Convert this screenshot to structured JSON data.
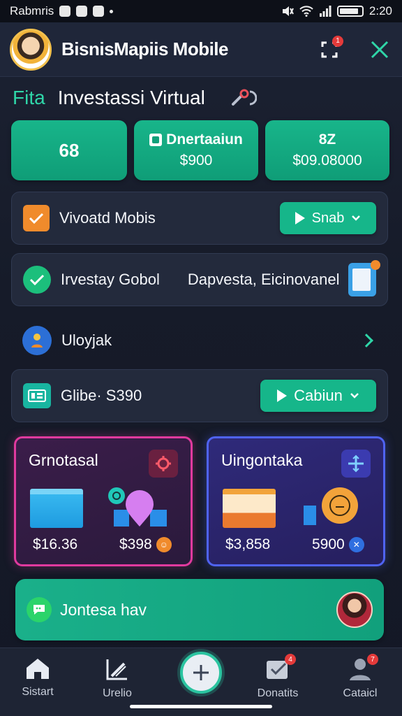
{
  "status_bar": {
    "carrier": "Rabmris",
    "time": "2:20"
  },
  "app": {
    "title": "BisnisMapiis Mobile",
    "notification_count": "1"
  },
  "section": {
    "tag": "Fita",
    "title": "Investassi Virtual"
  },
  "stats": [
    {
      "value": "68"
    },
    {
      "label": "Dnertaaiun",
      "value": "$900"
    },
    {
      "label": "8Z",
      "value": "$09.08000"
    }
  ],
  "rows": {
    "row1": {
      "label": "Vivoatd Mobis",
      "button": "Snab"
    },
    "row2": {
      "label": "Irvestay Gobol",
      "label2": "Dapvesta, Eicinovanel"
    },
    "row3": {
      "label": "Uloyjak"
    },
    "row4": {
      "label": "Glibe· S390",
      "button": "Cabiun"
    }
  },
  "tiles": [
    {
      "name": "Grnotasal",
      "amount1": "$16.36",
      "amount2": "$398",
      "accent": "#e03a9e"
    },
    {
      "name": "Uingontaka",
      "amount1": "$3,858",
      "amount2": "5900",
      "accent": "#4f63f2"
    }
  ],
  "promo": {
    "text": "Jontesa hav"
  },
  "nav": {
    "items": [
      {
        "label": "Sistart"
      },
      {
        "label": "Urelio"
      },
      {
        "label": "Donatits",
        "badge": "4"
      },
      {
        "label": "Cataicl",
        "badge": "7"
      }
    ]
  },
  "colors": {
    "accent": "#16b68a",
    "background": "#161b29"
  }
}
